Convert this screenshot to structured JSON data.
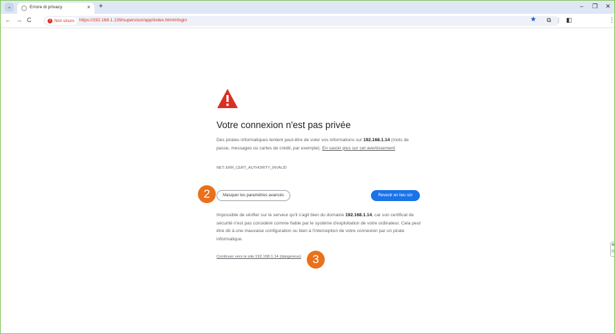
{
  "browser": {
    "tab_title": "Errore di privacy",
    "new_tab_symbol": "+",
    "tab_close_symbol": "×",
    "omnibox": {
      "security_label": "Non sicuro",
      "url": "https://192.168.1.139/supervisor/app/index.html#/login"
    }
  },
  "interstitial": {
    "heading": "Votre connexion n'est pas privée",
    "intro_part1": "Des pirates informatiques tentent peut-être de voler vos informations sur ",
    "intro_host": "192.168.1.14",
    "intro_part2": " (mots de passe, messages ou cartes de crédit, par exemple). ",
    "learn_more": "En savoir plus sur cet avertissement",
    "error_code": "NET::ERR_CERT_AUTHORITY_INVALID",
    "advanced_button": "Masquer les paramètres avancés",
    "back_button": "Revenir en lieu sûr",
    "details_part1": "Impossible de vérifier sur le serveur qu'il s'agit bien du domaine ",
    "details_host": "192.168.1.14",
    "details_part2": ", car son certificat de sécurité n'est pas considéré comme fiable par le système d'exploitation de votre ordinateur. Cela peut être dû à une mauvaise configuration ou bien à l'interception de votre connexion par un pirate informatique.",
    "proceed_link": "Continuer vers le site 192.168.1.14 (dangereux)"
  },
  "annotations": {
    "marker_2": "2",
    "marker_3": "3",
    "color": "#e9711c"
  },
  "colors": {
    "danger": "#d93025",
    "primary_button": "#1a73e8",
    "window_border": "#7fc45a"
  },
  "icons": [
    "tab-search-icon",
    "favicon-icon",
    "back-arrow-icon",
    "forward-arrow-icon",
    "reload-icon",
    "warning-icon",
    "star-icon",
    "extensions-icon",
    "side-panel-icon",
    "menu-icon",
    "minimize-icon",
    "restore-icon",
    "close-icon"
  ]
}
